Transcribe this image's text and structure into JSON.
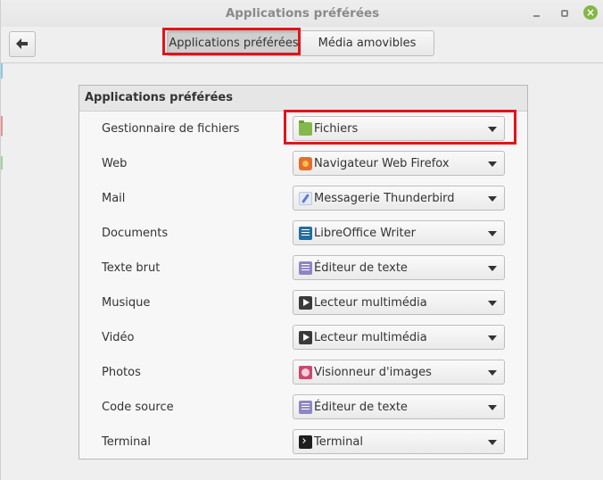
{
  "window": {
    "title": "Applications préférées"
  },
  "toolbar": {
    "tabs": [
      {
        "label": "Applications préférées",
        "selected": true
      },
      {
        "label": "Média amovibles",
        "selected": false
      }
    ]
  },
  "panel": {
    "header": "Applications préférées",
    "rows": [
      {
        "label": "Gestionnaire de fichiers",
        "value": "Fichiers",
        "icon": "folder-icon"
      },
      {
        "label": "Web",
        "value": "Navigateur Web Firefox",
        "icon": "firefox-icon"
      },
      {
        "label": "Mail",
        "value": "Messagerie Thunderbird",
        "icon": "thunderbird-icon"
      },
      {
        "label": "Documents",
        "value": "LibreOffice Writer",
        "icon": "libreoffice-writer-icon"
      },
      {
        "label": "Texte brut",
        "value": "Éditeur de texte",
        "icon": "text-editor-icon"
      },
      {
        "label": "Musique",
        "value": "Lecteur multimédia",
        "icon": "media-player-icon"
      },
      {
        "label": "Vidéo",
        "value": "Lecteur multimédia",
        "icon": "media-player-icon"
      },
      {
        "label": "Photos",
        "value": "Visionneur d'images",
        "icon": "image-viewer-icon"
      },
      {
        "label": "Code source",
        "value": "Éditeur de texte",
        "icon": "text-editor-icon"
      },
      {
        "label": "Terminal",
        "value": "Terminal",
        "icon": "terminal-icon"
      }
    ]
  },
  "colors": {
    "highlight": "#e1141b",
    "close_button": "#84b745"
  }
}
